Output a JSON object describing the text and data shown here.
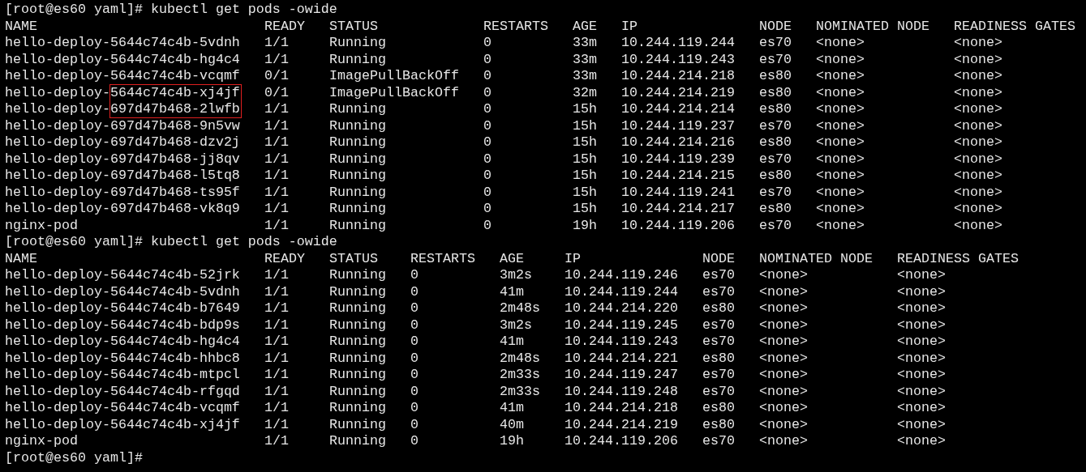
{
  "blocks": [
    {
      "prompt": "[root@es60 yaml]#",
      "command": "kubectl get pods -owide",
      "columns": [
        "NAME",
        "READY",
        "STATUS",
        "RESTARTS",
        "AGE",
        "IP",
        "NODE",
        "NOMINATED NODE",
        "READINESS GATES"
      ],
      "rows": [
        {
          "boxed": false,
          "cells": [
            "hello-deploy-5644c74c4b-5vdnh",
            "1/1",
            "Running",
            "0",
            "33m",
            "10.244.119.244",
            "es70",
            "<none>",
            "<none>"
          ]
        },
        {
          "boxed": false,
          "cells": [
            "hello-deploy-5644c74c4b-hg4c4",
            "1/1",
            "Running",
            "0",
            "33m",
            "10.244.119.243",
            "es70",
            "<none>",
            "<none>"
          ]
        },
        {
          "boxed": false,
          "cells": [
            "hello-deploy-5644c74c4b-vcqmf",
            "0/1",
            "ImagePullBackOff",
            "0",
            "33m",
            "10.244.214.218",
            "es80",
            "<none>",
            "<none>"
          ]
        },
        {
          "boxed": true,
          "cells": [
            "hello-deploy-5644c74c4b-xj4jf",
            "0/1",
            "ImagePullBackOff",
            "0",
            "32m",
            "10.244.214.219",
            "es80",
            "<none>",
            "<none>"
          ]
        },
        {
          "boxed": true,
          "cells": [
            "hello-deploy-697d47b468-2lwfb",
            "1/1",
            "Running",
            "0",
            "15h",
            "10.244.214.214",
            "es80",
            "<none>",
            "<none>"
          ]
        },
        {
          "boxed": false,
          "cells": [
            "hello-deploy-697d47b468-9n5vw",
            "1/1",
            "Running",
            "0",
            "15h",
            "10.244.119.237",
            "es70",
            "<none>",
            "<none>"
          ]
        },
        {
          "boxed": false,
          "cells": [
            "hello-deploy-697d47b468-dzv2j",
            "1/1",
            "Running",
            "0",
            "15h",
            "10.244.214.216",
            "es80",
            "<none>",
            "<none>"
          ]
        },
        {
          "boxed": false,
          "cells": [
            "hello-deploy-697d47b468-jj8qv",
            "1/1",
            "Running",
            "0",
            "15h",
            "10.244.119.239",
            "es70",
            "<none>",
            "<none>"
          ]
        },
        {
          "boxed": false,
          "cells": [
            "hello-deploy-697d47b468-l5tq8",
            "1/1",
            "Running",
            "0",
            "15h",
            "10.244.214.215",
            "es80",
            "<none>",
            "<none>"
          ]
        },
        {
          "boxed": false,
          "cells": [
            "hello-deploy-697d47b468-ts95f",
            "1/1",
            "Running",
            "0",
            "15h",
            "10.244.119.241",
            "es70",
            "<none>",
            "<none>"
          ]
        },
        {
          "boxed": false,
          "cells": [
            "hello-deploy-697d47b468-vk8q9",
            "1/1",
            "Running",
            "0",
            "15h",
            "10.244.214.217",
            "es80",
            "<none>",
            "<none>"
          ]
        },
        {
          "boxed": false,
          "cells": [
            "nginx-pod",
            "1/1",
            "Running",
            "0",
            "19h",
            "10.244.119.206",
            "es70",
            "<none>",
            "<none>"
          ]
        }
      ]
    },
    {
      "prompt": "[root@es60 yaml]#",
      "command": "kubectl get pods -owide",
      "columns": [
        "NAME",
        "READY",
        "STATUS",
        "RESTARTS",
        "AGE",
        "IP",
        "NODE",
        "NOMINATED NODE",
        "READINESS GATES"
      ],
      "rows": [
        {
          "boxed": false,
          "cells": [
            "hello-deploy-5644c74c4b-52jrk",
            "1/1",
            "Running",
            "0",
            "3m2s",
            "10.244.119.246",
            "es70",
            "<none>",
            "<none>"
          ]
        },
        {
          "boxed": false,
          "cells": [
            "hello-deploy-5644c74c4b-5vdnh",
            "1/1",
            "Running",
            "0",
            "41m",
            "10.244.119.244",
            "es70",
            "<none>",
            "<none>"
          ]
        },
        {
          "boxed": false,
          "cells": [
            "hello-deploy-5644c74c4b-b7649",
            "1/1",
            "Running",
            "0",
            "2m48s",
            "10.244.214.220",
            "es80",
            "<none>",
            "<none>"
          ]
        },
        {
          "boxed": false,
          "cells": [
            "hello-deploy-5644c74c4b-bdp9s",
            "1/1",
            "Running",
            "0",
            "3m2s",
            "10.244.119.245",
            "es70",
            "<none>",
            "<none>"
          ]
        },
        {
          "boxed": false,
          "cells": [
            "hello-deploy-5644c74c4b-hg4c4",
            "1/1",
            "Running",
            "0",
            "41m",
            "10.244.119.243",
            "es70",
            "<none>",
            "<none>"
          ]
        },
        {
          "boxed": false,
          "cells": [
            "hello-deploy-5644c74c4b-hhbc8",
            "1/1",
            "Running",
            "0",
            "2m48s",
            "10.244.214.221",
            "es80",
            "<none>",
            "<none>"
          ]
        },
        {
          "boxed": false,
          "cells": [
            "hello-deploy-5644c74c4b-mtpcl",
            "1/1",
            "Running",
            "0",
            "2m33s",
            "10.244.119.247",
            "es70",
            "<none>",
            "<none>"
          ]
        },
        {
          "boxed": false,
          "cells": [
            "hello-deploy-5644c74c4b-rfgqd",
            "1/1",
            "Running",
            "0",
            "2m33s",
            "10.244.119.248",
            "es70",
            "<none>",
            "<none>"
          ]
        },
        {
          "boxed": false,
          "cells": [
            "hello-deploy-5644c74c4b-vcqmf",
            "1/1",
            "Running",
            "0",
            "41m",
            "10.244.214.218",
            "es80",
            "<none>",
            "<none>"
          ]
        },
        {
          "boxed": false,
          "cells": [
            "hello-deploy-5644c74c4b-xj4jf",
            "1/1",
            "Running",
            "0",
            "40m",
            "10.244.214.219",
            "es80",
            "<none>",
            "<none>"
          ]
        },
        {
          "boxed": false,
          "cells": [
            "nginx-pod",
            "1/1",
            "Running",
            "0",
            "19h",
            "10.244.119.206",
            "es70",
            "<none>",
            "<none>"
          ]
        }
      ]
    }
  ],
  "last_prompt": "[root@es60 yaml]#"
}
